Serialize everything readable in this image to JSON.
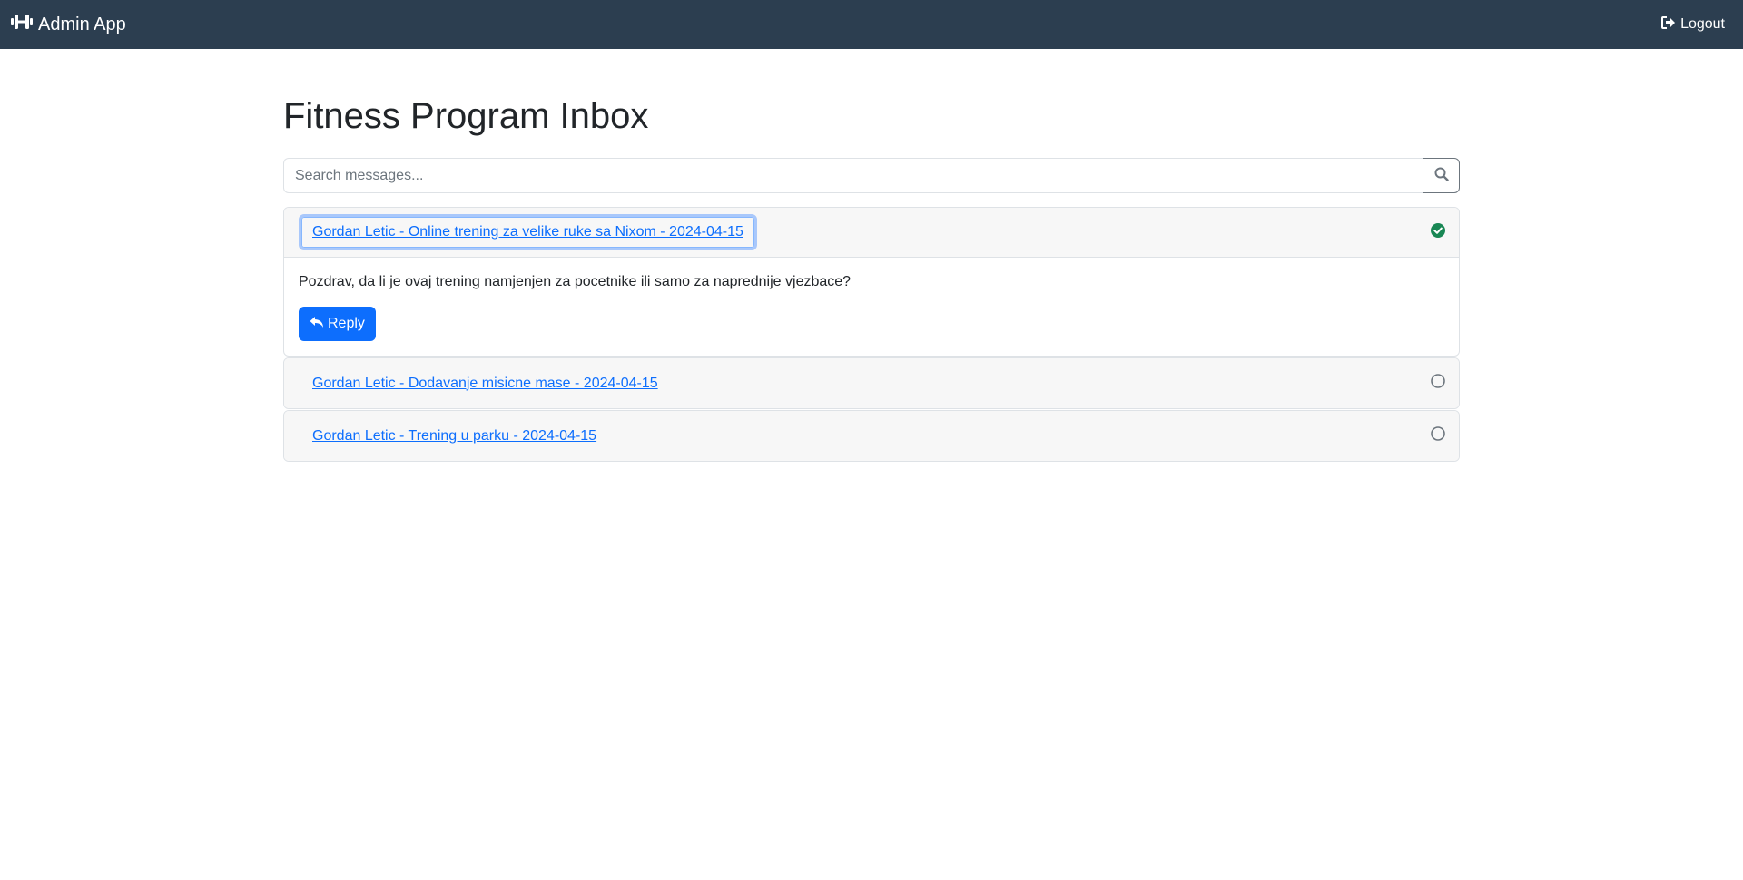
{
  "navbar": {
    "brand_icon": "dumbbell-icon",
    "brand_label": "Admin App",
    "logout_icon": "sign-out-icon",
    "logout_label": "Logout"
  },
  "page": {
    "title": "Fitness Program Inbox"
  },
  "search": {
    "placeholder": "Search messages...",
    "value": "",
    "button_icon": "search-icon"
  },
  "colors": {
    "navbar_bg": "#2c3e50",
    "link": "#0d6efd",
    "read_check": "#198754",
    "primary_button": "#0d6efd"
  },
  "messages": [
    {
      "title": "Gordan Letic - Online trening za velike ruke sa Nixom - 2024-04-15",
      "status_icon": "check-circle-icon",
      "read": true,
      "expanded": true,
      "body": "Pozdrav, da li je ovaj trening namjenjen za pocetnike ili samo za naprednije vjezbace?",
      "reply_icon": "reply-icon",
      "reply_label": "Reply"
    },
    {
      "title": "Gordan Letic - Dodavanje misicne mase - 2024-04-15",
      "status_icon": "circle-outline-icon",
      "read": false,
      "expanded": false
    },
    {
      "title": "Gordan Letic - Trening u parku - 2024-04-15",
      "status_icon": "circle-outline-icon",
      "read": false,
      "expanded": false
    }
  ]
}
